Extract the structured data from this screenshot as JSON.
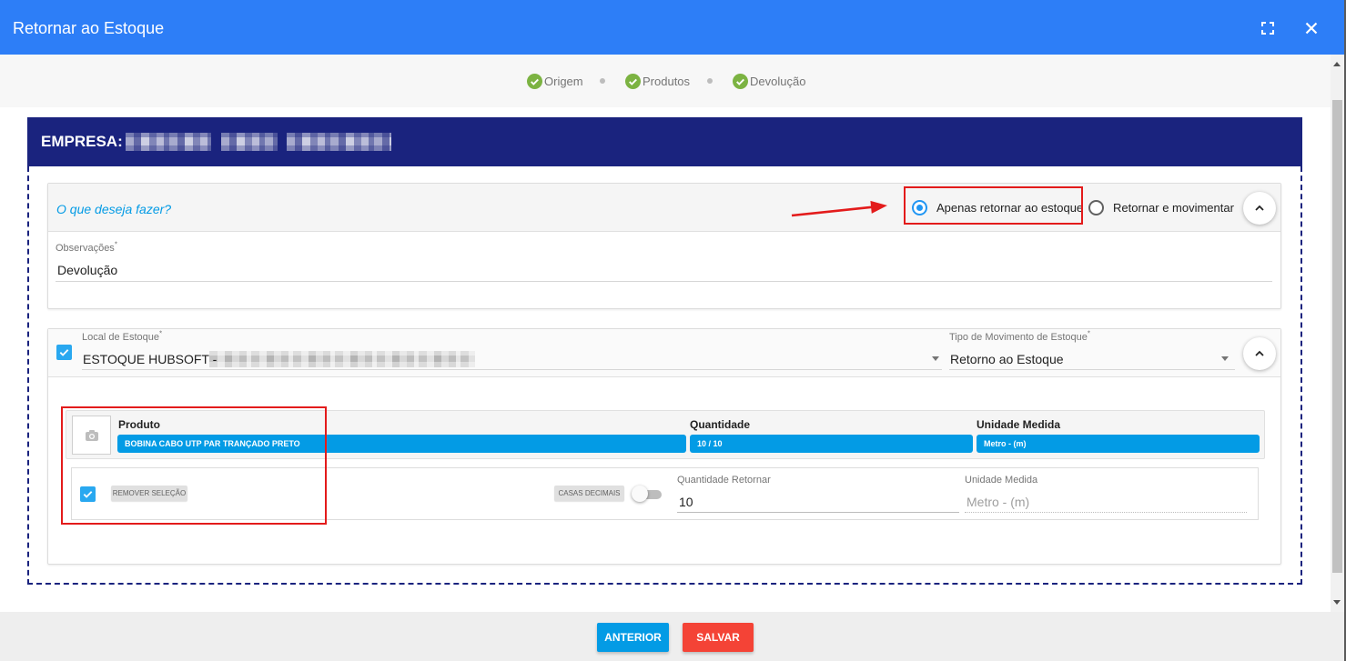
{
  "colors": {
    "header": "#2d7ef7",
    "navy": "#1a237e",
    "accent": "#039be5",
    "radio": "#2196f3",
    "checkbox": "#29a8f0",
    "success": "#7cb342",
    "danger": "#f44336",
    "annotation": "#e31b1b"
  },
  "dialog": {
    "title": "Retornar ao Estoque",
    "fullscreen_icon": "fullscreen-icon",
    "close_icon": "close-icon"
  },
  "steps": [
    {
      "label": "Origem",
      "icon": "check-circle-icon",
      "done": true
    },
    {
      "label": "Produtos",
      "icon": "check-circle-icon",
      "done": true
    },
    {
      "label": "Devolução",
      "icon": "check-circle-icon",
      "done": true
    }
  ],
  "empresa": {
    "label": "EMPRESA:"
  },
  "acao": {
    "question": "O que deseja fazer?",
    "options": [
      {
        "label": "Apenas retornar ao estoque",
        "selected": true
      },
      {
        "label": "Retornar e movimentar",
        "selected": false
      }
    ],
    "collapse_icon": "chevron-up-icon",
    "observacoes": {
      "label": "Observações",
      "required": "*",
      "value": "Devolução"
    }
  },
  "estoque": {
    "selected": true,
    "local": {
      "label": "Local de Estoque",
      "required": "*",
      "value": "ESTOQUE HUBSOFT -"
    },
    "tipo": {
      "label": "Tipo de Movimento de Estoque",
      "required": "*",
      "value": "Retorno ao Estoque"
    },
    "dropdown_icon": "dropdown-arrow-icon",
    "collapse_icon": "chevron-up-icon",
    "produto": {
      "photo_icon": "camera-icon",
      "columns": [
        "Produto",
        "Quantidade",
        "Unidade Medida"
      ],
      "values": [
        "BOBINA CABO UTP PAR TRANÇADO PRETO",
        "10 / 10",
        "Metro - (m)"
      ]
    },
    "item": {
      "selected": true,
      "remove_label": "REMOVER SELEÇÃO",
      "decimals_label": "CASAS DECIMAIS",
      "decimals_enabled": false,
      "quantidade": {
        "label": "Quantidade Retornar",
        "value": "10"
      },
      "unidade": {
        "label": "Unidade Medida",
        "value": "Metro - (m)"
      }
    }
  },
  "footer": {
    "previous_label": "ANTERIOR",
    "save_label": "SALVAR"
  }
}
